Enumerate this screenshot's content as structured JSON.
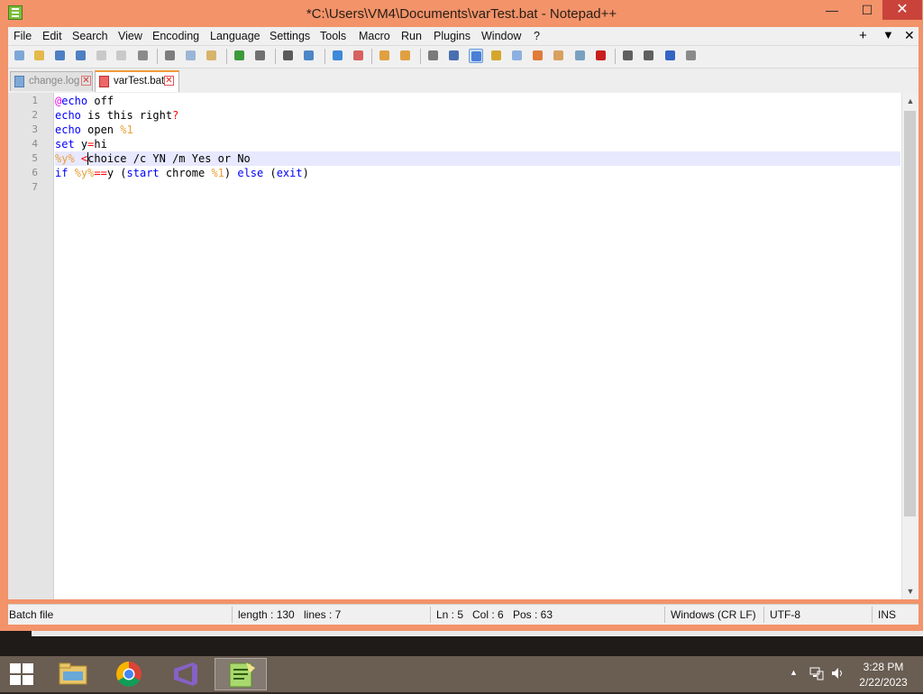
{
  "window": {
    "title": "*C:\\Users\\VM4\\Documents\\varTest.bat - Notepad++",
    "controls": {
      "minimize": "—",
      "maximize": "☐",
      "close": "✕"
    }
  },
  "menu": {
    "items": [
      "File",
      "Edit",
      "Search",
      "View",
      "Encoding",
      "Language",
      "Settings",
      "Tools",
      "Macro",
      "Run",
      "Plugins",
      "Window",
      "?"
    ],
    "right": {
      "new_icon": "+",
      "list_icon": "▼",
      "close_icon": "✕"
    }
  },
  "toolbar": {
    "icons": [
      "new-file",
      "open-file",
      "save",
      "save-all",
      "close",
      "close-all",
      "print",
      "cut",
      "copy",
      "paste",
      "undo",
      "redo",
      "find",
      "replace",
      "zoom-in",
      "zoom-out",
      "sync-vertical",
      "sync-horizontal",
      "word-wrap",
      "show-all-chars",
      "indent-guide",
      "user-define-lang",
      "doc-map",
      "function-list",
      "folder-as-workspace",
      "monitoring",
      "record-macro",
      "stop-recording",
      "playback-macro",
      "run-macro-multiple",
      "save-macro"
    ],
    "active_icon": "indent-guide"
  },
  "tabs": [
    {
      "label": "change.log",
      "close": "✕",
      "active": false
    },
    {
      "label": "varTest.bat",
      "close": "✕",
      "active": true
    }
  ],
  "editor": {
    "line_numbers": [
      "1",
      "2",
      "3",
      "4",
      "5",
      "6",
      "7"
    ],
    "current_line": 5,
    "lines": [
      [
        {
          "t": "@",
          "c": "at"
        },
        {
          "t": "echo",
          "c": "kw"
        },
        {
          "t": " off",
          "c": ""
        }
      ],
      [
        {
          "t": "echo",
          "c": "kw"
        },
        {
          "t": " is this right",
          "c": ""
        },
        {
          "t": "?",
          "c": "op"
        }
      ],
      [
        {
          "t": "echo",
          "c": "kw"
        },
        {
          "t": " open ",
          "c": ""
        },
        {
          "t": "%1",
          "c": "var"
        }
      ],
      [
        {
          "t": "set",
          "c": "kw"
        },
        {
          "t": " y",
          "c": ""
        },
        {
          "t": "=",
          "c": "op"
        },
        {
          "t": "hi",
          "c": ""
        }
      ],
      [
        {
          "t": "%y%",
          "c": "var"
        },
        {
          "t": " ",
          "c": ""
        },
        {
          "t": "<",
          "c": "op"
        },
        {
          "t": "choice /c YN /m Yes or No",
          "c": ""
        }
      ],
      [
        {
          "t": "if",
          "c": "kw"
        },
        {
          "t": " ",
          "c": ""
        },
        {
          "t": "%y%",
          "c": "var"
        },
        {
          "t": "==",
          "c": "op"
        },
        {
          "t": "y (",
          "c": ""
        },
        {
          "t": "start",
          "c": "kw"
        },
        {
          "t": " chrome ",
          "c": ""
        },
        {
          "t": "%1",
          "c": "var"
        },
        {
          "t": ") ",
          "c": ""
        },
        {
          "t": "else",
          "c": "kw"
        },
        {
          "t": " (",
          "c": ""
        },
        {
          "t": "exit",
          "c": "kw"
        },
        {
          "t": ")",
          "c": ""
        }
      ],
      []
    ],
    "colors": {
      "keyword": "#0000ff",
      "variable": "#e8a13b",
      "operator": "#ff0000",
      "label": "#ff00ff",
      "current_line": "#e8e8ff"
    }
  },
  "status": {
    "file_type": "Batch file",
    "length": "length : 130",
    "lines": "lines : 7",
    "ln": "Ln : 5",
    "col": "Col : 6",
    "pos": "Pos : 63",
    "eol": "Windows (CR LF)",
    "encoding": "UTF-8",
    "mode": "INS"
  },
  "taskbar": {
    "apps": [
      "file-explorer",
      "chrome",
      "visual-studio",
      "notepad++"
    ],
    "running": "notepad++",
    "tray": {
      "arrow": "▲"
    },
    "clock": {
      "time": "3:28 PM",
      "date": "2/22/2023"
    }
  }
}
